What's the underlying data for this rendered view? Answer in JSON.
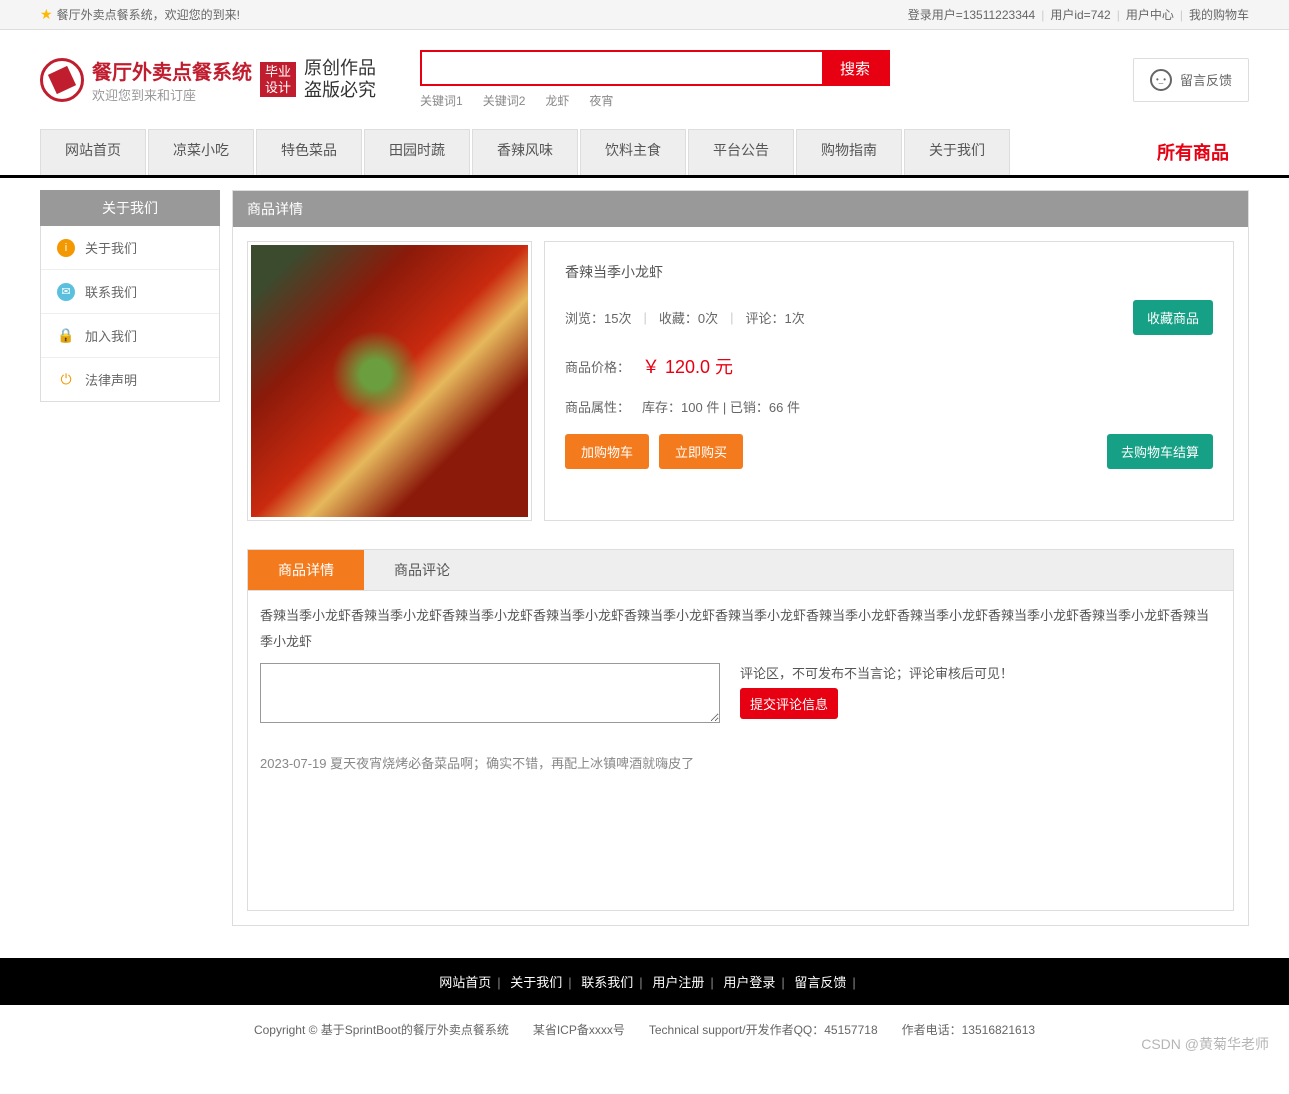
{
  "topbar": {
    "welcome": "餐厅外卖点餐系统，欢迎您的到来!",
    "login_user_label": "登录用户=13511223344",
    "user_id_label": "用户id=742",
    "user_center": "用户中心",
    "my_cart": "我的购物车"
  },
  "logo": {
    "title": "餐厅外卖点餐系统",
    "subtitle": "欢迎您到来和订座",
    "badge": "毕业设计",
    "slogan1": "原创作品",
    "slogan2": "盗版必究"
  },
  "search": {
    "button": "搜索",
    "keywords": [
      "关键词1",
      "关键词2",
      "龙虾",
      "夜宵"
    ]
  },
  "feedback": "留言反馈",
  "nav": {
    "items": [
      "网站首页",
      "凉菜小吃",
      "特色菜品",
      "田园时蔬",
      "香辣风味",
      "饮料主食",
      "平台公告",
      "购物指南",
      "关于我们"
    ],
    "all": "所有商品"
  },
  "sidebar": {
    "title": "关于我们",
    "items": [
      {
        "label": "关于我们"
      },
      {
        "label": "联系我们"
      },
      {
        "label": "加入我们"
      },
      {
        "label": "法律声明"
      }
    ]
  },
  "detail": {
    "header": "商品详情",
    "name": "香辣当季小龙虾",
    "views_label": "浏览：",
    "views_value": "15次",
    "fav_label": "收藏：",
    "fav_value": "0次",
    "comment_label": "评论：",
    "comment_value": "1次",
    "collect_btn": "收藏商品",
    "price_label": "商品价格：",
    "price_value": "￥ 120.0 元",
    "attr_label": "商品属性：",
    "stock_text": "库存：100 件 | 已销：66 件",
    "add_cart": "加购物车",
    "buy_now": "立即购买",
    "checkout": "去购物车结算"
  },
  "tabs": {
    "detail": "商品详情",
    "comments": "商品评论"
  },
  "content": {
    "description": "香辣当季小龙虾香辣当季小龙虾香辣当季小龙虾香辣当季小龙虾香辣当季小龙虾香辣当季小龙虾香辣当季小龙虾香辣当季小龙虾香辣当季小龙虾香辣当季小龙虾香辣当季小龙虾",
    "comment_hint": "评论区，不可发布不当言论；评论审核后可见！",
    "submit_btn": "提交评论信息",
    "comment1": "2023-07-19 夏天夜宵烧烤必备菜品啊；确实不错，再配上冰镇啤酒就嗨皮了"
  },
  "footer": {
    "links": [
      "网站首页",
      "关于我们",
      "联系我们",
      "用户注册",
      "用户登录",
      "留言反馈"
    ],
    "copyright": "Copyright © 基于SprintBoot的餐厅外卖点餐系统　　某省ICP备xxxx号　　Technical support/开发作者QQ：45157718　　作者电话：13516821613"
  },
  "watermark": "CSDN @黄菊华老师"
}
